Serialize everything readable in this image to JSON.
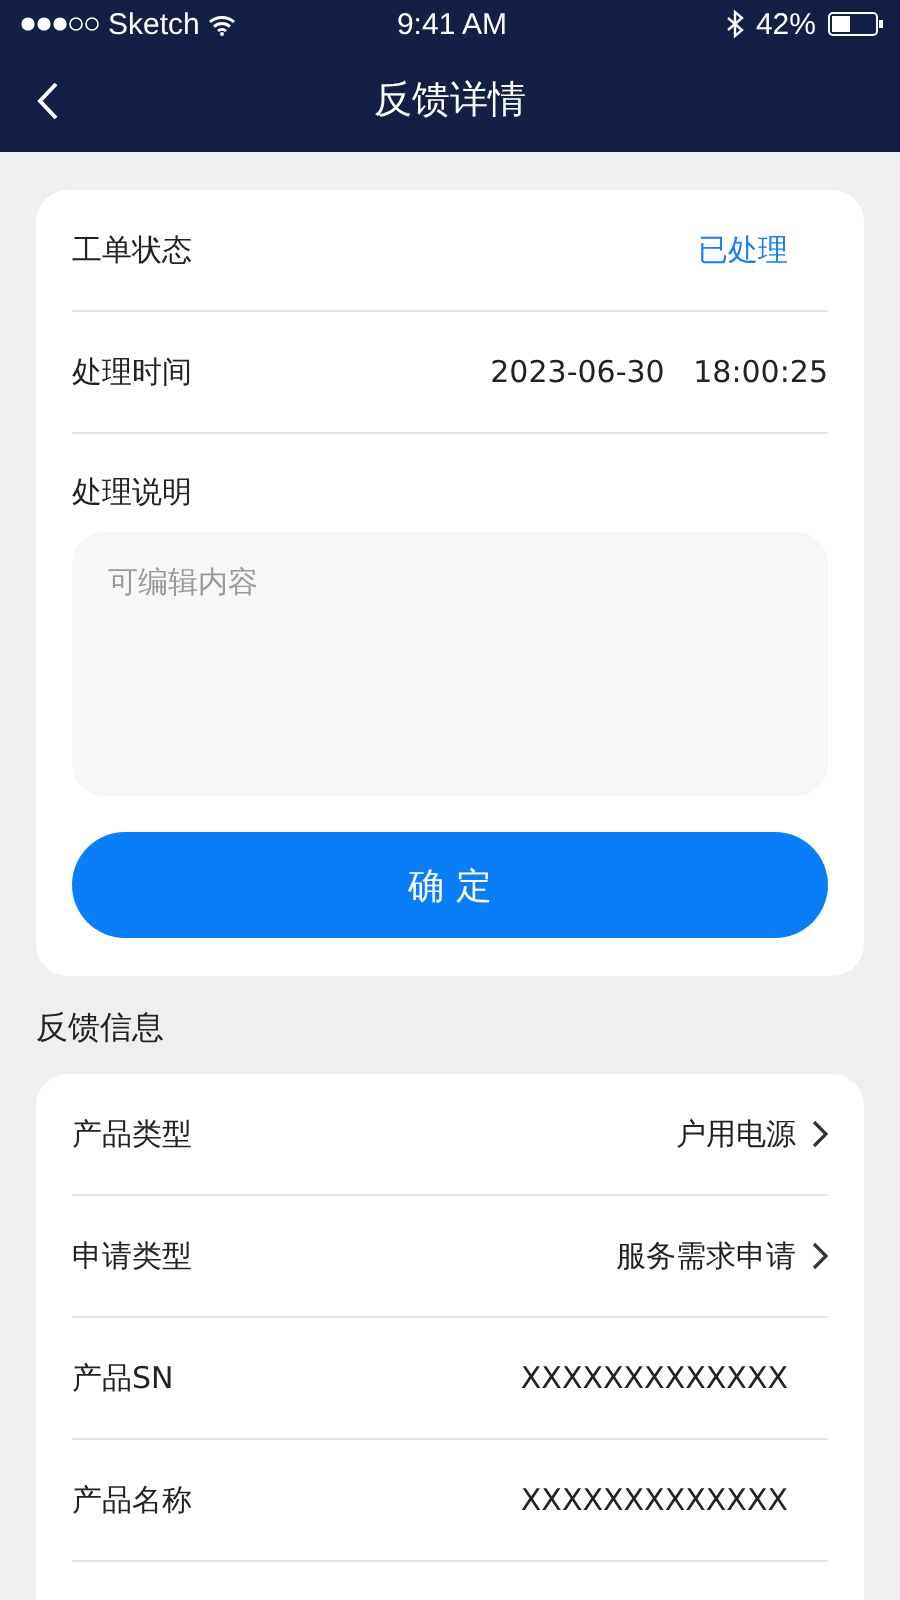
{
  "status_bar": {
    "carrier": "Sketch",
    "time": "9:41 AM",
    "battery": "42%"
  },
  "nav": {
    "title": "反馈详情"
  },
  "ticket": {
    "rows": [
      {
        "kind": "status",
        "label": "工单状态",
        "value": "已处理"
      },
      {
        "kind": "plain",
        "label": "处理时间",
        "value": "2023-06-30   18:00:25"
      }
    ],
    "note": {
      "label": "处理说明",
      "placeholder": "可编辑内容"
    },
    "confirm": "确 定"
  },
  "feedback": {
    "title": "反馈信息",
    "rows": [
      {
        "label": "产品类型",
        "value": "户用电源",
        "link": true
      },
      {
        "label": "申请类型",
        "value": "服务需求申请",
        "link": true
      },
      {
        "label": "产品SN",
        "value": "XXXXXXXXXXXXX",
        "link": false
      },
      {
        "label": "产品名称",
        "value": "XXXXXXXXXXXXX",
        "link": false
      }
    ]
  }
}
